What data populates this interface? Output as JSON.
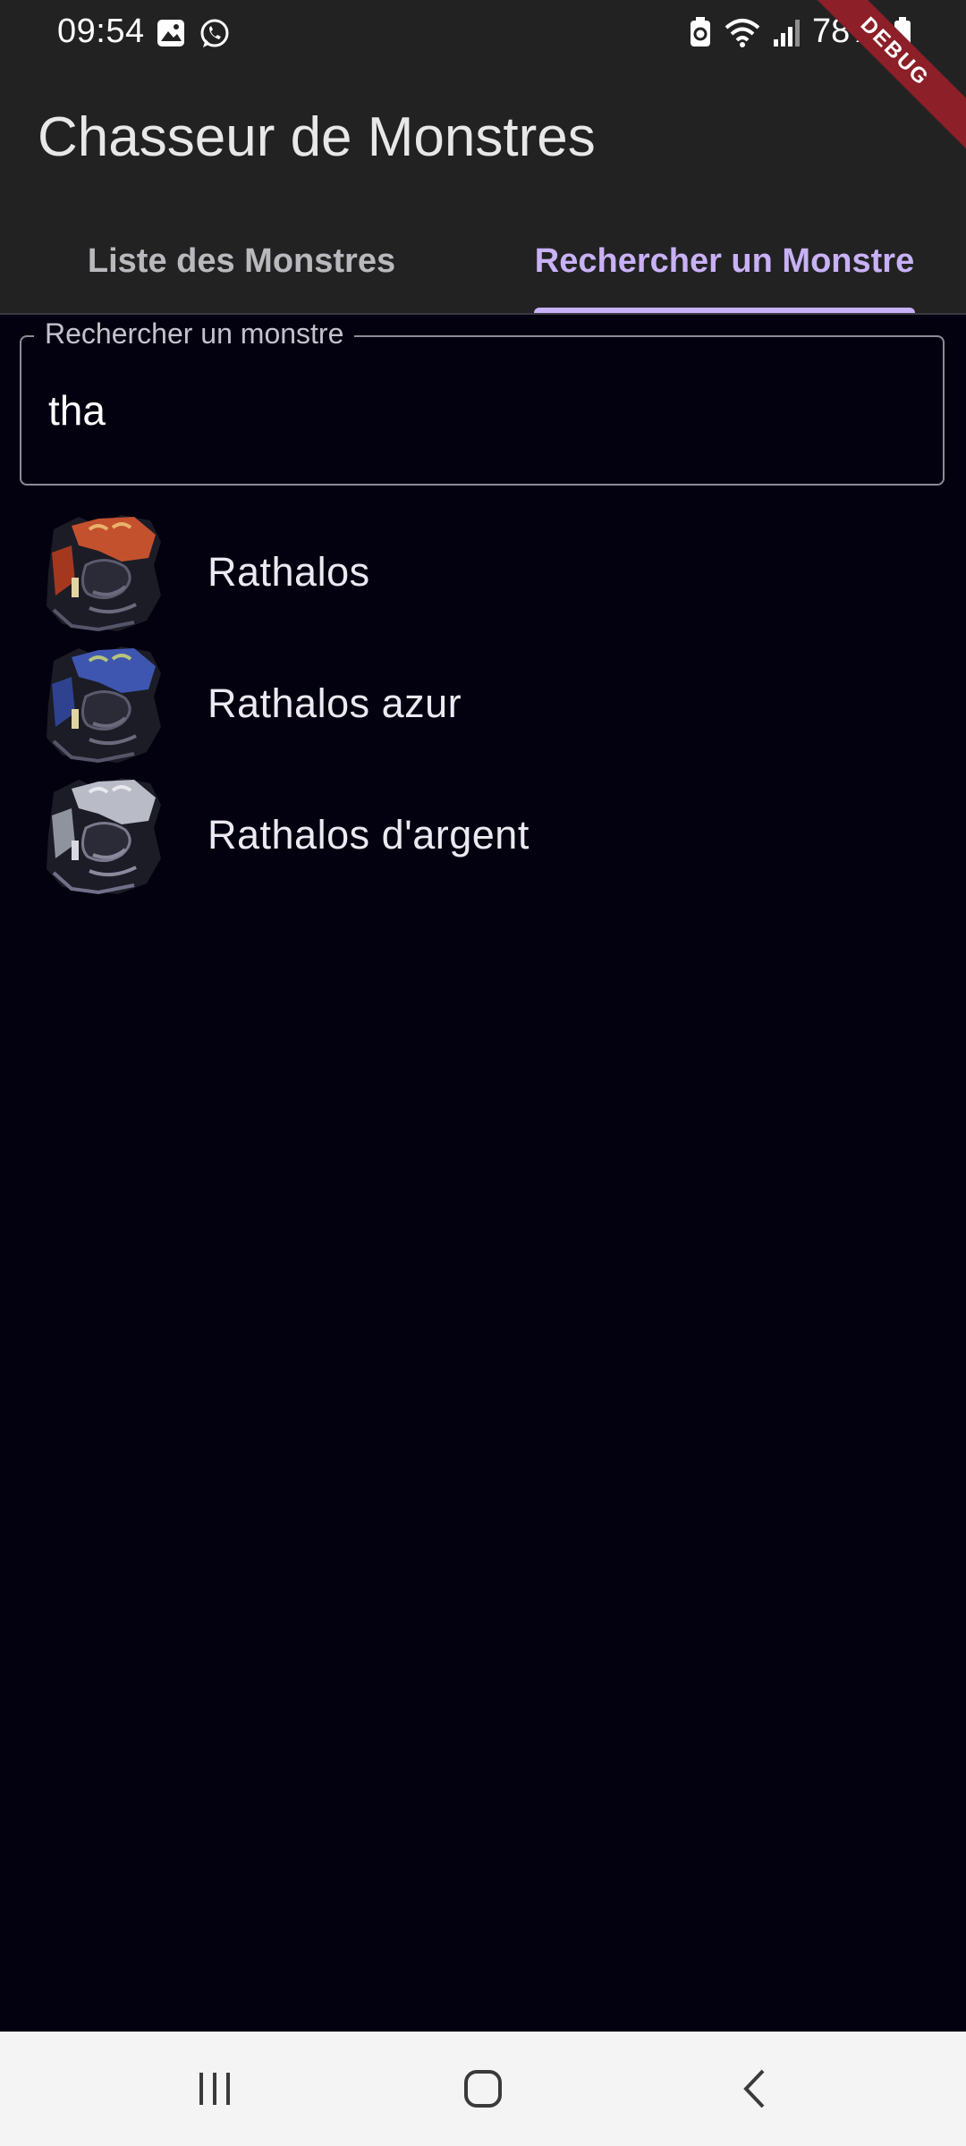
{
  "status_bar": {
    "time": "09:54",
    "battery": "78%",
    "left_icons": [
      "gallery-icon",
      "whatsapp-icon"
    ],
    "right_icons": [
      "battery-saver-icon",
      "wifi-icon",
      "signal-icon",
      "battery-icon"
    ]
  },
  "debug_banner": "DEBUG",
  "app_bar": {
    "title": "Chasseur de Monstres"
  },
  "tabs": [
    {
      "label": "Liste des Monstres",
      "active": false
    },
    {
      "label": "Rechercher un Monstre",
      "active": true
    }
  ],
  "search": {
    "label": "Rechercher un monstre",
    "value": "tha"
  },
  "results": [
    {
      "name": "Rathalos",
      "icon": "rathalos-icon",
      "color": "#c4512e"
    },
    {
      "name": "Rathalos azur",
      "icon": "azure-rathalos-icon",
      "color": "#3e56b0"
    },
    {
      "name": "Rathalos d'argent",
      "icon": "silver-rathalos-icon",
      "color": "#b9bcc6"
    }
  ],
  "nav_bar": {
    "buttons": [
      "recent-apps-icon",
      "home-icon",
      "back-icon"
    ]
  },
  "colors": {
    "background": "#03000f",
    "header": "#222222",
    "accent": "#c8b1f6",
    "nav_bar": "#f4f4f4"
  }
}
